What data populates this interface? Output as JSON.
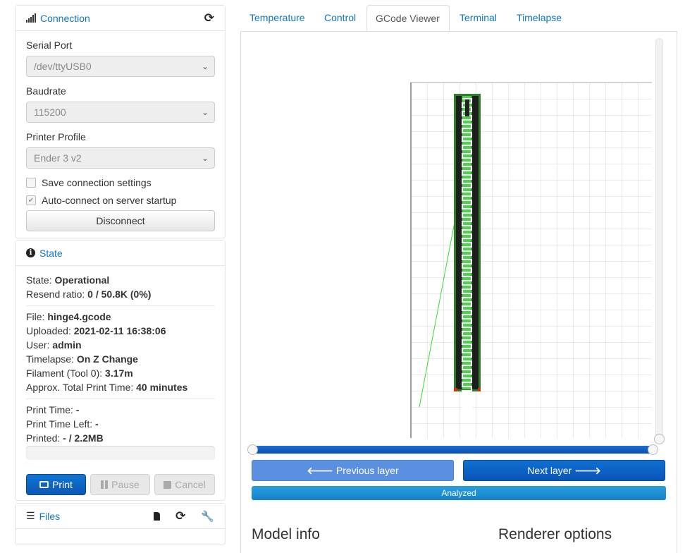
{
  "connection": {
    "title": "Connection",
    "serial_port_label": "Serial Port",
    "serial_port_value": "/dev/ttyUSB0",
    "baudrate_label": "Baudrate",
    "baudrate_value": "115200",
    "profile_label": "Printer Profile",
    "profile_value": "Ender 3 v2",
    "save_settings_label": "Save connection settings",
    "autoconnect_label": "Auto-connect on server startup",
    "disconnect_label": "Disconnect"
  },
  "state": {
    "title": "State",
    "rows": [
      {
        "label": "State: ",
        "value": "Operational"
      },
      {
        "label": "Resend ratio: ",
        "value": "0 / 50.8K (0%)"
      },
      {
        "label": "File: ",
        "value": "hinge4.gcode"
      },
      {
        "label": "Uploaded: ",
        "value": "2021-02-11 16:38:06"
      },
      {
        "label": "User: ",
        "value": "admin"
      },
      {
        "label": "Timelapse: ",
        "value": "On Z Change"
      },
      {
        "label": "Filament (Tool 0): ",
        "value": "3.17m"
      },
      {
        "label": "Approx. Total Print Time: ",
        "value": "40 minutes"
      },
      {
        "label": "Print Time: ",
        "value": "-"
      },
      {
        "label": "Print Time Left: ",
        "value": "-"
      },
      {
        "label": "Printed: ",
        "value": "- / 2.2MB"
      }
    ],
    "print_label": "Print",
    "pause_label": "Pause",
    "cancel_label": "Cancel",
    "progress": 0
  },
  "files": {
    "title": "Files"
  },
  "tabs": [
    "Temperature",
    "Control",
    "GCode Viewer",
    "Terminal",
    "Timelapse"
  ],
  "viewer": {
    "prev_label": "Previous layer",
    "next_label": "Next layer",
    "analyzed_label": "Analyzed",
    "layer_slider": 1.0,
    "model_info_title": "Model info",
    "renderer_options_title": "Renderer options"
  },
  "colors": {
    "accent": "#0f77c0",
    "primary": "#0d5fc0",
    "analyzed": "#1a8fd6",
    "prev": "#5b8fe0"
  }
}
